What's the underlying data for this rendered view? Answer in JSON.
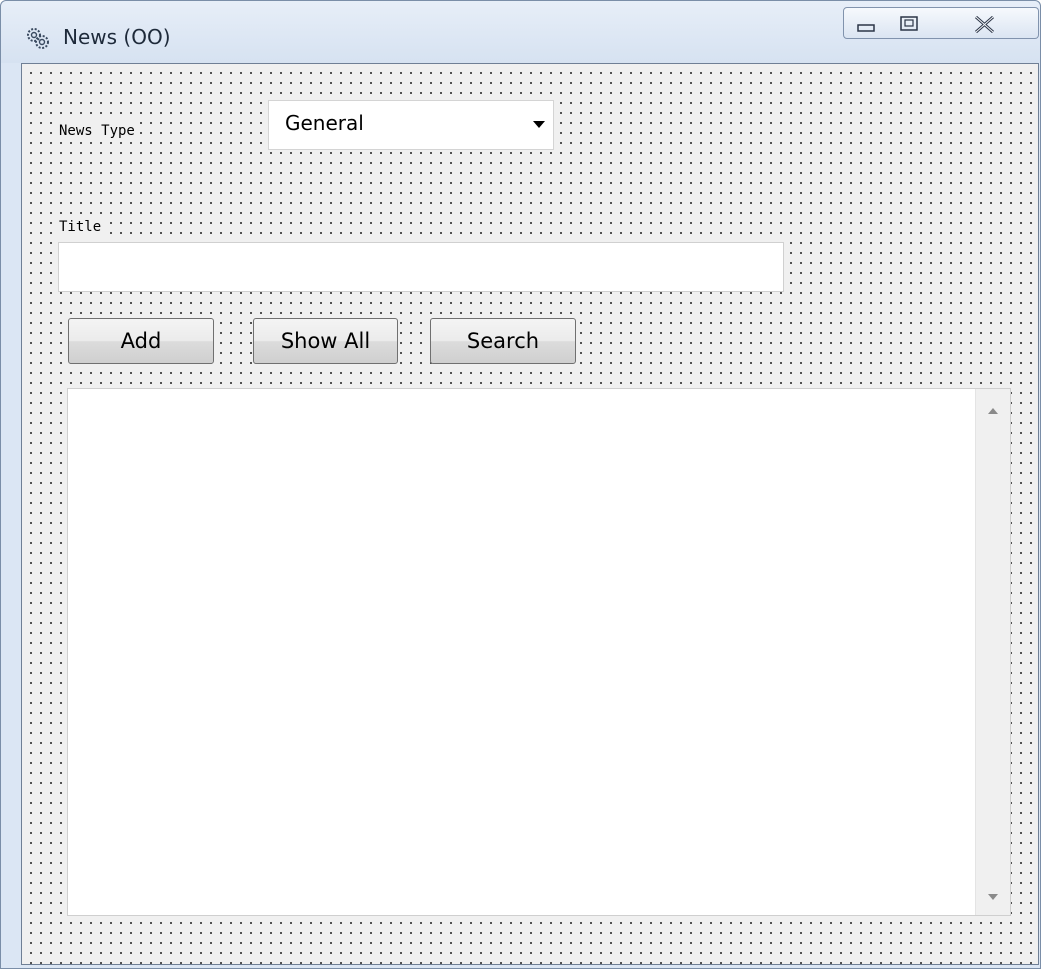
{
  "window": {
    "title": "News (OO)",
    "icon": "app-gears-icon",
    "controls": [
      "minimize-icon",
      "maximize-icon",
      "close-icon"
    ]
  },
  "form": {
    "news_type_label": "News Type",
    "news_type_value": "General",
    "title_label": "Title",
    "title_value": "",
    "buttons": {
      "add": "Add",
      "show_all": "Show All",
      "search": "Search"
    },
    "results_list": []
  },
  "colors": {
    "client_background": "#f0f0f0",
    "grid_dot": "#2a2a2a",
    "titlebar": "#dbe6f4"
  }
}
